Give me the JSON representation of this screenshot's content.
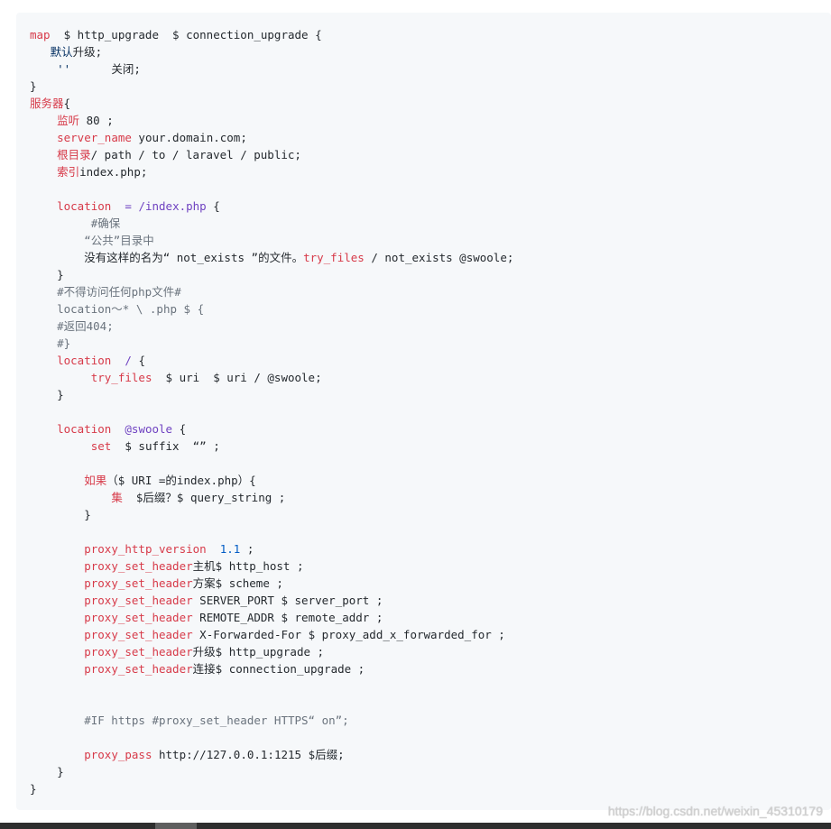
{
  "colors": {
    "page_background": "#ffffff",
    "code_background": "#f6f8fa",
    "code_text": "#24292e",
    "keyword": "#d73a49",
    "value": "#6f42c1",
    "number": "#005cc5",
    "string": "#032f62",
    "comment": "#6a737d",
    "watermark": "#d0d0d0",
    "scrollbar_track": "#2e2e2e",
    "scrollbar_thumb": "#5f5f5f"
  },
  "code": {
    "lines": [
      [
        {
          "t": "map",
          "c": "#d73a49"
        },
        {
          "t": "  $ http_upgrade  $ connection_upgrade {"
        }
      ],
      [
        {
          "t": "   "
        },
        {
          "t": "默认",
          "c": "#032f62"
        },
        {
          "t": "升级;"
        }
      ],
      [
        {
          "t": "    "
        },
        {
          "t": "''",
          "c": "#032f62"
        },
        {
          "t": "      关闭;"
        }
      ],
      [
        {
          "t": "}"
        }
      ],
      [
        {
          "t": "服务器",
          "c": "#d73a49"
        },
        {
          "t": "{"
        }
      ],
      [
        {
          "t": "    "
        },
        {
          "t": "监听",
          "c": "#d73a49"
        },
        {
          "t": " 80 ;"
        }
      ],
      [
        {
          "t": "    "
        },
        {
          "t": "server_name",
          "c": "#d73a49"
        },
        {
          "t": " your.domain.com;"
        }
      ],
      [
        {
          "t": "    "
        },
        {
          "t": "根目录",
          "c": "#d73a49"
        },
        {
          "t": "/ path / to / laravel / public;"
        }
      ],
      [
        {
          "t": "    "
        },
        {
          "t": "索引",
          "c": "#d73a49"
        },
        {
          "t": "index.php;"
        }
      ],
      [],
      [
        {
          "t": "    "
        },
        {
          "t": "location",
          "c": "#d73a49"
        },
        {
          "t": "  "
        },
        {
          "t": "= /index.php",
          "c": "#6f42c1"
        },
        {
          "t": " {"
        }
      ],
      [
        {
          "t": "         #确保",
          "c": "#6a737d"
        }
      ],
      [
        {
          "t": "        “公共”目录中",
          "c": "#6a737d"
        }
      ],
      [
        {
          "t": "        没有这样的名为“ not_exists ”的文件。"
        },
        {
          "t": "try_files",
          "c": "#d73a49"
        },
        {
          "t": " / not_exists @swoole;"
        }
      ],
      [
        {
          "t": "    }"
        }
      ],
      [
        {
          "t": "    #不得访问任何php文件#",
          "c": "#6a737d"
        }
      ],
      [
        {
          "t": "    location〜* \\ .php $ {",
          "c": "#6a737d"
        }
      ],
      [
        {
          "t": "    #返回404;",
          "c": "#6a737d"
        }
      ],
      [
        {
          "t": "    #}",
          "c": "#6a737d"
        }
      ],
      [
        {
          "t": "    "
        },
        {
          "t": "location",
          "c": "#d73a49"
        },
        {
          "t": "  "
        },
        {
          "t": "/",
          "c": "#6f42c1"
        },
        {
          "t": " {"
        }
      ],
      [
        {
          "t": "         "
        },
        {
          "t": "try_files",
          "c": "#d73a49"
        },
        {
          "t": "  $ uri  $ uri / @swoole;"
        }
      ],
      [
        {
          "t": "    }"
        }
      ],
      [],
      [
        {
          "t": "    "
        },
        {
          "t": "location",
          "c": "#d73a49"
        },
        {
          "t": "  "
        },
        {
          "t": "@swoole",
          "c": "#6f42c1"
        },
        {
          "t": " {"
        }
      ],
      [
        {
          "t": "         "
        },
        {
          "t": "set",
          "c": "#d73a49"
        },
        {
          "t": "  $ suffix  “” ;"
        }
      ],
      [],
      [
        {
          "t": "        "
        },
        {
          "t": "如果",
          "c": "#d73a49"
        },
        {
          "t": "（$ URI =的index.php）{"
        }
      ],
      [
        {
          "t": "            "
        },
        {
          "t": "集",
          "c": "#d73a49"
        },
        {
          "t": "  $后缀？$ query_string ;"
        }
      ],
      [
        {
          "t": "        }"
        }
      ],
      [],
      [
        {
          "t": "        "
        },
        {
          "t": "proxy_http_version",
          "c": "#d73a49"
        },
        {
          "t": "  "
        },
        {
          "t": "1.1",
          "c": "#005cc5"
        },
        {
          "t": " ;"
        }
      ],
      [
        {
          "t": "        "
        },
        {
          "t": "proxy_set_header",
          "c": "#d73a49"
        },
        {
          "t": "主机$ http_host ;"
        }
      ],
      [
        {
          "t": "        "
        },
        {
          "t": "proxy_set_header",
          "c": "#d73a49"
        },
        {
          "t": "方案$ scheme ;"
        }
      ],
      [
        {
          "t": "        "
        },
        {
          "t": "proxy_set_header",
          "c": "#d73a49"
        },
        {
          "t": " SERVER_PORT $ server_port ;"
        }
      ],
      [
        {
          "t": "        "
        },
        {
          "t": "proxy_set_header",
          "c": "#d73a49"
        },
        {
          "t": " REMOTE_ADDR $ remote_addr ;"
        }
      ],
      [
        {
          "t": "        "
        },
        {
          "t": "proxy_set_header",
          "c": "#d73a49"
        },
        {
          "t": " X-Forwarded-For $ proxy_add_x_forwarded_for ;"
        }
      ],
      [
        {
          "t": "        "
        },
        {
          "t": "proxy_set_header",
          "c": "#d73a49"
        },
        {
          "t": "升级$ http_upgrade ;"
        }
      ],
      [
        {
          "t": "        "
        },
        {
          "t": "proxy_set_header",
          "c": "#d73a49"
        },
        {
          "t": "连接$ connection_upgrade ;"
        }
      ],
      [],
      [],
      [
        {
          "t": "        #IF https #proxy_set_header HTTPS“ on”;",
          "c": "#6a737d"
        }
      ],
      [],
      [
        {
          "t": "        "
        },
        {
          "t": "proxy_pass",
          "c": "#d73a49"
        },
        {
          "t": " http://127.0.0.1:1215 $后缀;"
        }
      ],
      [
        {
          "t": "    }"
        }
      ],
      [
        {
          "t": "}"
        }
      ]
    ]
  },
  "watermark": "https://blog.csdn.net/weixin_45310179"
}
